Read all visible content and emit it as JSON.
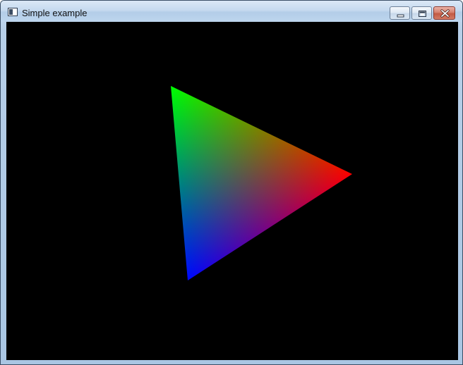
{
  "window": {
    "title": "Simple example",
    "icons": {
      "app": "application-window-icon",
      "minimize": "minimize-icon",
      "maximize": "maximize-icon",
      "close": "close-icon"
    }
  },
  "scene": {
    "background_color": "#000000",
    "triangle": {
      "vertex_colors": [
        "#00ff00",
        "#ff0000",
        "#0000ff"
      ]
    }
  }
}
